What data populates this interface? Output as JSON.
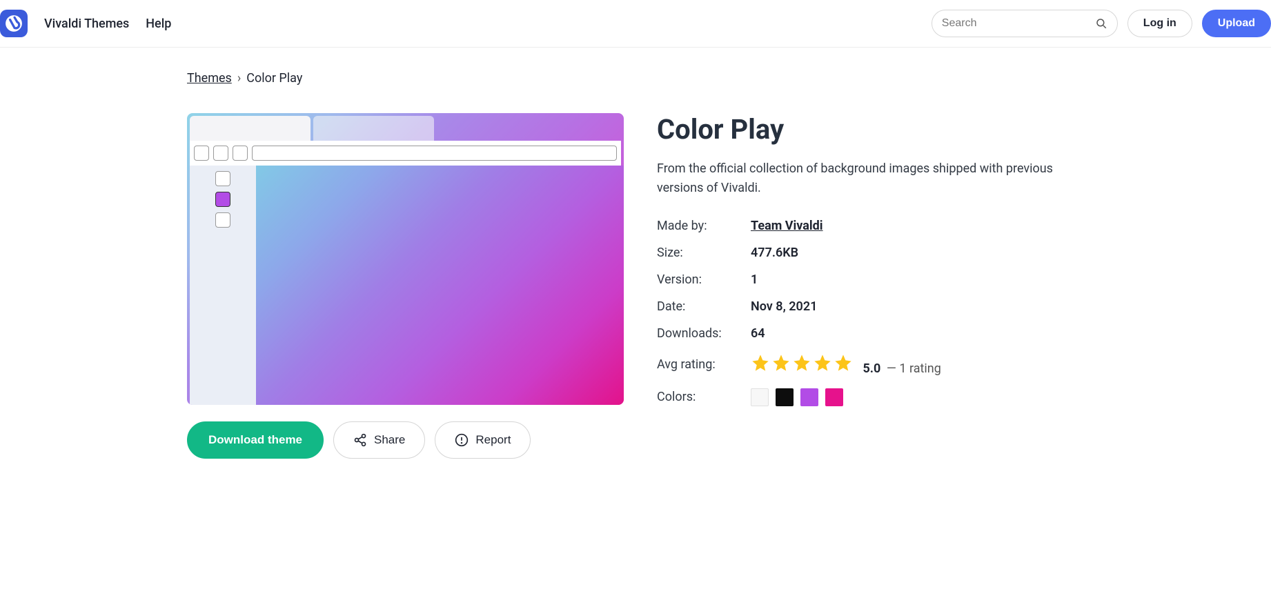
{
  "header": {
    "nav": {
      "brand": "Vivaldi Themes",
      "help": "Help"
    },
    "search": {
      "placeholder": "Search"
    },
    "login_label": "Log in",
    "upload_label": "Upload"
  },
  "breadcrumb": {
    "root": "Themes",
    "current": "Color Play"
  },
  "actions": {
    "download": "Download theme",
    "share": "Share",
    "report": "Report"
  },
  "theme": {
    "title": "Color Play",
    "description": "From the official collection of background images shipped with previous versions of Vivaldi.",
    "labels": {
      "made_by": "Made by:",
      "size": "Size:",
      "version": "Version:",
      "date": "Date:",
      "downloads": "Downloads:",
      "avg_rating": "Avg rating:",
      "colors": "Colors:"
    },
    "author": "Team Vivaldi",
    "size": "477.6KB",
    "version": "1",
    "date": "Nov 8, 2021",
    "downloads": "64",
    "rating_value": "5.0",
    "rating_count_text": "— 1 rating",
    "colors": [
      "#f7f7f7",
      "#0d0d0d",
      "#b24ce6",
      "#e6128c"
    ]
  }
}
